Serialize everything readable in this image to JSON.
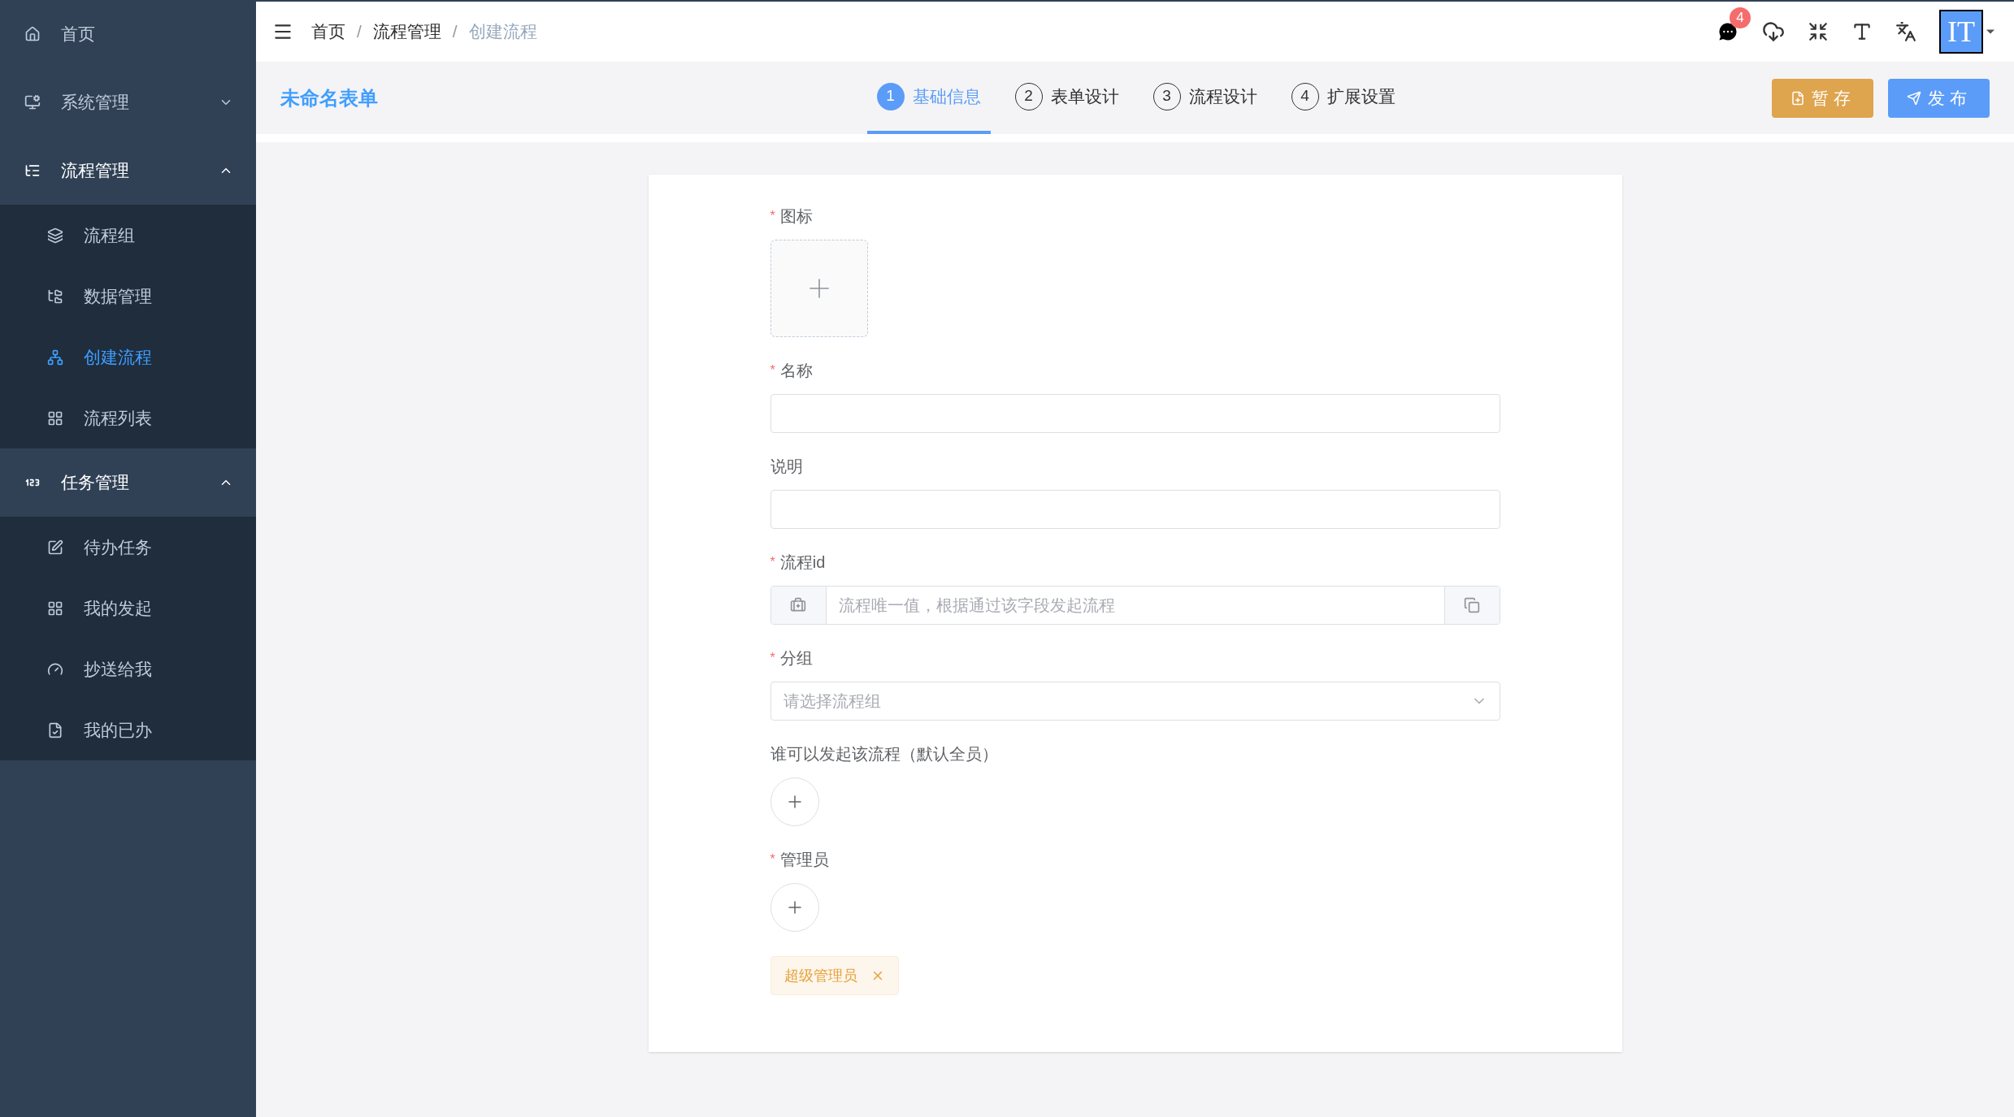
{
  "sidebar": {
    "items": [
      {
        "label": "首页",
        "kind": "link"
      },
      {
        "label": "系统管理",
        "kind": "group",
        "expanded": false
      },
      {
        "label": "流程管理",
        "kind": "group",
        "expanded": true,
        "children": [
          {
            "label": "流程组",
            "selected": false
          },
          {
            "label": "数据管理",
            "selected": false
          },
          {
            "label": "创建流程",
            "selected": true
          },
          {
            "label": "流程列表",
            "selected": false
          }
        ]
      },
      {
        "label": "任务管理",
        "kind": "group",
        "expanded": true,
        "children": [
          {
            "label": "待办任务",
            "selected": false
          },
          {
            "label": "我的发起",
            "selected": false
          },
          {
            "label": "抄送给我",
            "selected": false
          },
          {
            "label": "我的已办",
            "selected": false
          }
        ]
      }
    ]
  },
  "topbar": {
    "breadcrumb": [
      {
        "label": "首页",
        "current": false
      },
      {
        "label": "流程管理",
        "current": false
      },
      {
        "label": "创建流程",
        "current": true
      }
    ],
    "separator": "/",
    "notification_count": "4",
    "avatar_text": "IT"
  },
  "form_header": {
    "title": "未命名表单",
    "steps": [
      {
        "number": "1",
        "label": "基础信息",
        "selected": true
      },
      {
        "number": "2",
        "label": "表单设计",
        "selected": false
      },
      {
        "number": "3",
        "label": "流程设计",
        "selected": false
      },
      {
        "number": "4",
        "label": "扩展设置",
        "selected": false
      }
    ],
    "buttons": [
      {
        "label": "暂存",
        "kind": "save"
      },
      {
        "label": "发布",
        "kind": "publish"
      }
    ]
  },
  "form": {
    "required_mark": "*",
    "fields": [
      {
        "kind": "icon-upload",
        "label": "图标",
        "required": true
      },
      {
        "kind": "text",
        "label": "名称",
        "required": true
      },
      {
        "kind": "text",
        "label": "说明",
        "required": false
      },
      {
        "kind": "id",
        "label": "流程id",
        "required": true,
        "placeholder": "流程唯一值，根据通过该字段发起流程"
      },
      {
        "kind": "select",
        "label": "分组",
        "required": true,
        "placeholder": "请选择流程组"
      },
      {
        "kind": "user-picker",
        "label": "谁可以发起该流程（默认全员）",
        "required": false
      },
      {
        "kind": "user-picker",
        "label": "管理员",
        "required": true,
        "tags": [
          "超级管理员"
        ]
      }
    ]
  }
}
